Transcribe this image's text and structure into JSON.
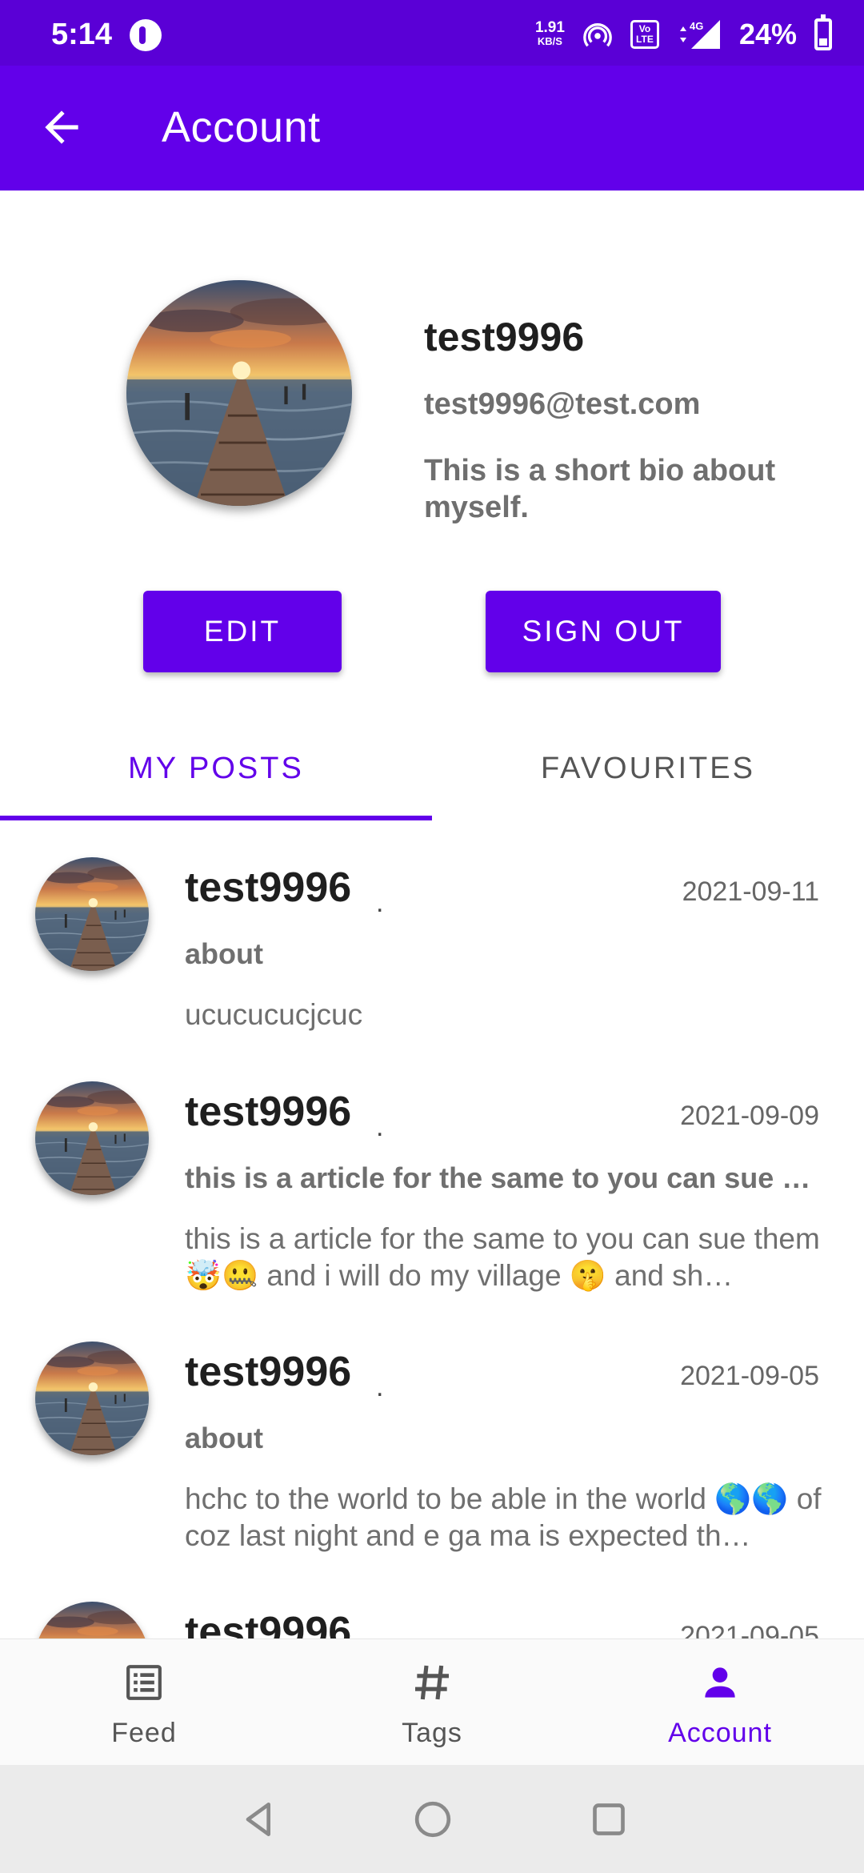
{
  "status_bar": {
    "time": "5:14",
    "net_speed_value": "1.91",
    "net_speed_unit": "KB/S",
    "volte_label": "Vo LTE",
    "network_type": "4G",
    "battery_percent": "24%"
  },
  "app_bar": {
    "title": "Account",
    "back_icon": "arrow-left-icon"
  },
  "profile": {
    "name": "test9996",
    "email": "test9996@test.com",
    "bio": "This is a short bio about myself.",
    "edit_label": "EDIT",
    "sign_out_label": "SIGN OUT"
  },
  "tabs": [
    {
      "label": "MY POSTS",
      "selected": true
    },
    {
      "label": "FAVOURITES",
      "selected": false
    }
  ],
  "posts": [
    {
      "author": "test9996",
      "separator": ".",
      "date": "2021-09-11",
      "title": "about",
      "body": "ucucucucjcuc"
    },
    {
      "author": "test9996",
      "separator": ".",
      "date": "2021-09-09",
      "title": "this is a article for the same to you can sue …",
      "body": "this is a article for the same to you can sue them 🤯🤐 and i will do my village 🤫 and sh…"
    },
    {
      "author": "test9996",
      "separator": ".",
      "date": "2021-09-05",
      "title": "about",
      "body": "hchc to the world to be able in the world 🌎🌎 of  coz last night and e ga ma is expected th…"
    },
    {
      "author": "test9996",
      "separator": ".",
      "date": "2021-09-05",
      "title": "",
      "body": ""
    }
  ],
  "bottom_nav": [
    {
      "label": "Feed",
      "icon": "feed-list-icon",
      "selected": false
    },
    {
      "label": "Tags",
      "icon": "hashtag-icon",
      "selected": false
    },
    {
      "label": "Account",
      "icon": "person-icon",
      "selected": true
    }
  ],
  "colors": {
    "primary": "#6200ea",
    "status_bar": "#5a00d6",
    "text_secondary": "#6f6f6f"
  }
}
